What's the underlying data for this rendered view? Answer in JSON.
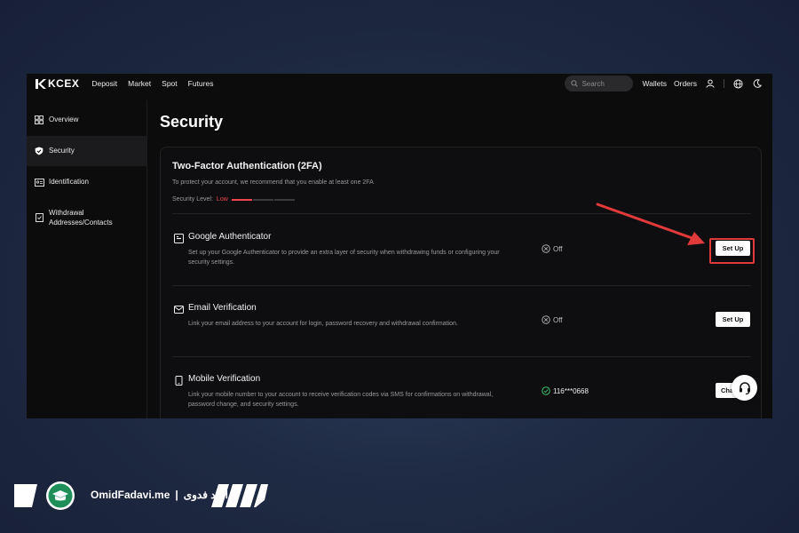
{
  "nav": {
    "logo": "KCEX",
    "items": [
      "Deposit",
      "Market",
      "Spot",
      "Futures"
    ],
    "search_placeholder": "Search",
    "right_items": [
      "Wallets",
      "Orders"
    ],
    "icons": [
      "user-icon",
      "globe-icon",
      "moon-icon"
    ]
  },
  "sidebar": {
    "items": [
      {
        "label": "Overview",
        "icon": "overview-icon",
        "active": false
      },
      {
        "label": "Security",
        "icon": "shield-icon",
        "active": true
      },
      {
        "label": "Identification",
        "icon": "id-card-icon",
        "active": false
      },
      {
        "label": "Withdrawal Addresses/Contacts",
        "icon": "address-book-icon",
        "active": false
      }
    ]
  },
  "page": {
    "title": "Security"
  },
  "twofa": {
    "title": "Two-Factor Authentication (2FA)",
    "subtitle": "To protect your account, we recommend that you enable at least one 2FA",
    "level_label": "Security Level:",
    "level_value": "Low",
    "level_segments_on": 1,
    "level_segments_total": 4,
    "methods": [
      {
        "title": "Google Authenticator",
        "icon": "authenticator-icon",
        "desc": "Set up your Google Authenticator to provide an extra layer of security when withdrawing funds or configuring your security settings.",
        "status": "Off",
        "status_icon": "off-circle-icon",
        "button": "Set Up"
      },
      {
        "title": "Email Verification",
        "icon": "email-icon",
        "desc": "Link your email address to your account for login, password recovery and withdrawal confirmation.",
        "status": "Off",
        "status_icon": "off-circle-icon",
        "button": "Set Up"
      },
      {
        "title": "Mobile Verification",
        "icon": "mobile-icon",
        "desc": "Link your mobile number to your account to receive verification codes via SMS for confirmations on withdrawal, password change, and security settings.",
        "status": "116***0668",
        "status_icon": "check-circle-icon",
        "button": "Cha"
      }
    ]
  },
  "colors": {
    "accent_red": "#f0454f",
    "arrow_red": "#e23a3a",
    "success_green": "#3cc46e"
  },
  "watermark": {
    "text_en": "OmidFadavi.me",
    "separator": "|",
    "text_fa": "امید فدوی"
  }
}
